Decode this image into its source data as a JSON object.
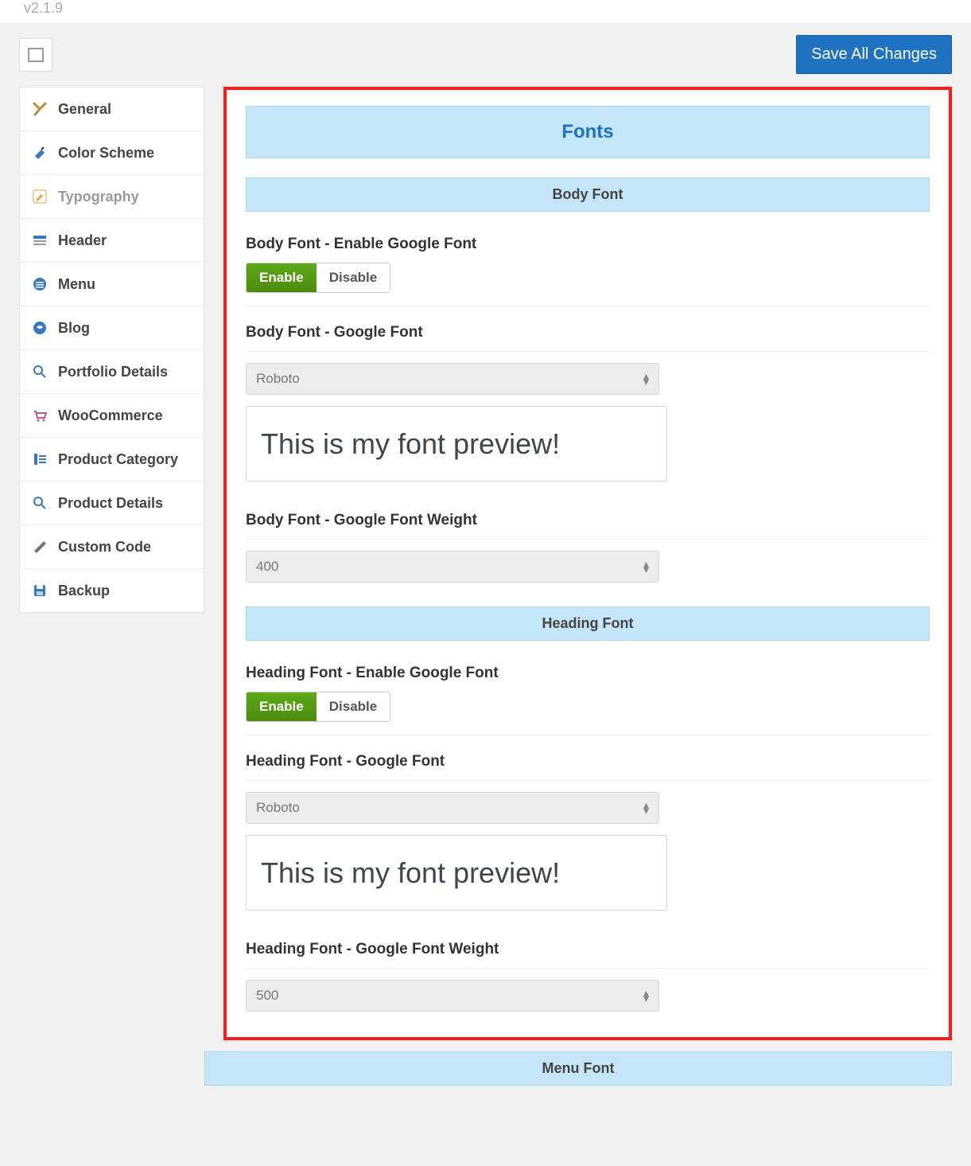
{
  "header": {
    "version": "v2.1.9",
    "save_button": "Save All Changes"
  },
  "sidebar": {
    "items": [
      {
        "id": "general",
        "label": "General"
      },
      {
        "id": "color-scheme",
        "label": "Color Scheme"
      },
      {
        "id": "typography",
        "label": "Typography"
      },
      {
        "id": "header",
        "label": "Header"
      },
      {
        "id": "menu",
        "label": "Menu"
      },
      {
        "id": "blog",
        "label": "Blog"
      },
      {
        "id": "portfolio-details",
        "label": "Portfolio Details"
      },
      {
        "id": "woocommerce",
        "label": "WooCommerce"
      },
      {
        "id": "product-category",
        "label": "Product Category"
      },
      {
        "id": "product-details",
        "label": "Product Details"
      },
      {
        "id": "custom-code",
        "label": "Custom Code"
      },
      {
        "id": "backup",
        "label": "Backup"
      }
    ],
    "active": "typography"
  },
  "main": {
    "section_title": "Fonts",
    "body_font": {
      "subsection": "Body Font",
      "enable_label": "Body Font - Enable Google Font",
      "toggle_on": "Enable",
      "toggle_off": "Disable",
      "font_label": "Body Font - Google Font",
      "font_value": "Roboto",
      "preview_text": "This is my font preview!",
      "weight_label": "Body Font - Google Font Weight",
      "weight_value": "400"
    },
    "heading_font": {
      "subsection": "Heading Font",
      "enable_label": "Heading Font - Enable Google Font",
      "toggle_on": "Enable",
      "toggle_off": "Disable",
      "font_label": "Heading Font - Google Font",
      "font_value": "Roboto",
      "preview_text": "This is my font preview!",
      "weight_label": "Heading Font - Google Font Weight",
      "weight_value": "500"
    },
    "menu_font": {
      "subsection": "Menu Font"
    }
  }
}
